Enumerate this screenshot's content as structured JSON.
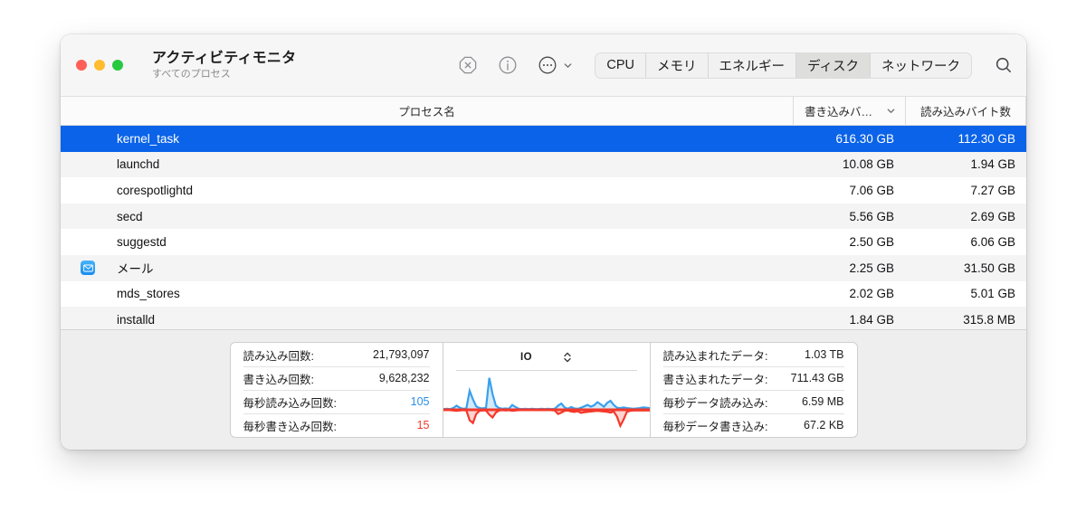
{
  "window": {
    "title": "アクティビティモニタ",
    "subtitle": "すべてのプロセス",
    "traffic": {
      "close": "close-button",
      "minimize": "minimize-button",
      "zoom": "zoom-button"
    }
  },
  "toolbar": {
    "quit_icon": "quit-process-icon",
    "info_icon": "inspect-info-icon",
    "more_icon": "more-options-icon",
    "more_chevron": "chevron-down-icon",
    "search_icon": "search-icon",
    "tabs": [
      {
        "label": "CPU",
        "active": false
      },
      {
        "label": "メモリ",
        "active": false
      },
      {
        "label": "エネルギー",
        "active": false
      },
      {
        "label": "ディスク",
        "active": true
      },
      {
        "label": "ネットワーク",
        "active": false
      }
    ]
  },
  "table": {
    "columns": {
      "name": "プロセス名",
      "written": "書き込みバ…",
      "read": "読み込みバイト数",
      "sort_icon": "chevron-down-icon"
    },
    "rows": [
      {
        "name": "kernel_task",
        "written": "616.30 GB",
        "read": "112.30 GB",
        "selected": true,
        "icon": null
      },
      {
        "name": "launchd",
        "written": "10.08 GB",
        "read": "1.94 GB",
        "selected": false,
        "icon": null
      },
      {
        "name": "corespotlightd",
        "written": "7.06 GB",
        "read": "7.27 GB",
        "selected": false,
        "icon": null
      },
      {
        "name": "secd",
        "written": "5.56 GB",
        "read": "2.69 GB",
        "selected": false,
        "icon": null
      },
      {
        "name": "suggestd",
        "written": "2.50 GB",
        "read": "6.06 GB",
        "selected": false,
        "icon": null
      },
      {
        "name": "メール",
        "written": "2.25 GB",
        "read": "31.50 GB",
        "selected": false,
        "icon": "mail-app-icon"
      },
      {
        "name": "mds_stores",
        "written": "2.02 GB",
        "read": "5.01 GB",
        "selected": false,
        "icon": null
      },
      {
        "name": "installd",
        "written": "1.84 GB",
        "read": "315.8 MB",
        "selected": false,
        "icon": null
      }
    ]
  },
  "footer": {
    "left_stats": [
      {
        "label": "読み込み回数:",
        "value": "21,793,097",
        "color": "default"
      },
      {
        "label": "書き込み回数:",
        "value": "9,628,232",
        "color": "default"
      },
      {
        "label": "毎秒読み込み回数:",
        "value": "105",
        "color": "blue"
      },
      {
        "label": "毎秒書き込み回数:",
        "value": "15",
        "color": "red"
      }
    ],
    "right_stats": [
      {
        "label": "読み込まれたデータ:",
        "value": "1.03 TB",
        "color": "default"
      },
      {
        "label": "書き込まれたデータ:",
        "value": "711.43 GB",
        "color": "default"
      },
      {
        "label": "毎秒データ読み込み:",
        "value": "6.59 MB",
        "color": "default"
      },
      {
        "label": "毎秒データ書き込み:",
        "value": "67.2 KB",
        "color": "default"
      }
    ],
    "graph": {
      "title": "IO",
      "stepper_icon": "up-down-stepper-icon",
      "read_color": "#3aa0ec",
      "write_color": "#f4392b"
    }
  },
  "colors": {
    "selection_blue": "#0a63e8",
    "read_blue": "#2a8fe8",
    "write_red": "#f0392b",
    "traffic_red": "#ff5f57",
    "traffic_yellow": "#febc2e",
    "traffic_green": "#28c840"
  },
  "chart_data": {
    "type": "area",
    "title": "IO",
    "xlabel": "",
    "ylabel": "",
    "grid": false,
    "legend": "none",
    "series": [
      {
        "name": "読み込み",
        "color": "#3aa0ec",
        "values": [
          0.02,
          0.03,
          0.02,
          0.05,
          0.12,
          0.06,
          0.03,
          0.04,
          0.55,
          0.3,
          0.1,
          0.05,
          0.04,
          0.06,
          0.92,
          0.45,
          0.12,
          0.05,
          0.03,
          0.04,
          0.03,
          0.14,
          0.08,
          0.03,
          0.02,
          0.03,
          0.02,
          0.03,
          0.02,
          0.02,
          0.03,
          0.02,
          0.03,
          0.02,
          0.03,
          0.12,
          0.18,
          0.07,
          0.03,
          0.08,
          0.04,
          0.03,
          0.06,
          0.1,
          0.14,
          0.09,
          0.13,
          0.22,
          0.16,
          0.09,
          0.2,
          0.26,
          0.14,
          0.06,
          0.05,
          0.07,
          0.05,
          0.04,
          0.03,
          0.04,
          0.05,
          0.07,
          0.06,
          0.05
        ]
      },
      {
        "name": "書き込み",
        "color": "#f4392b",
        "values": [
          0.01,
          0.01,
          0.01,
          0.02,
          0.03,
          0.02,
          0.01,
          0.02,
          0.3,
          0.38,
          0.12,
          0.03,
          0.02,
          0.02,
          0.14,
          0.22,
          0.08,
          0.02,
          0.01,
          0.02,
          0.01,
          0.03,
          0.02,
          0.01,
          0.01,
          0.01,
          0.01,
          0.01,
          0.01,
          0.01,
          0.01,
          0.01,
          0.01,
          0.01,
          0.02,
          0.12,
          0.08,
          0.03,
          0.02,
          0.05,
          0.06,
          0.04,
          0.09,
          0.07,
          0.06,
          0.05,
          0.04,
          0.03,
          0.04,
          0.05,
          0.06,
          0.08,
          0.05,
          0.2,
          0.46,
          0.28,
          0.06,
          0.03,
          0.02,
          0.02,
          0.02,
          0.02,
          0.02,
          0.02
        ]
      }
    ]
  }
}
